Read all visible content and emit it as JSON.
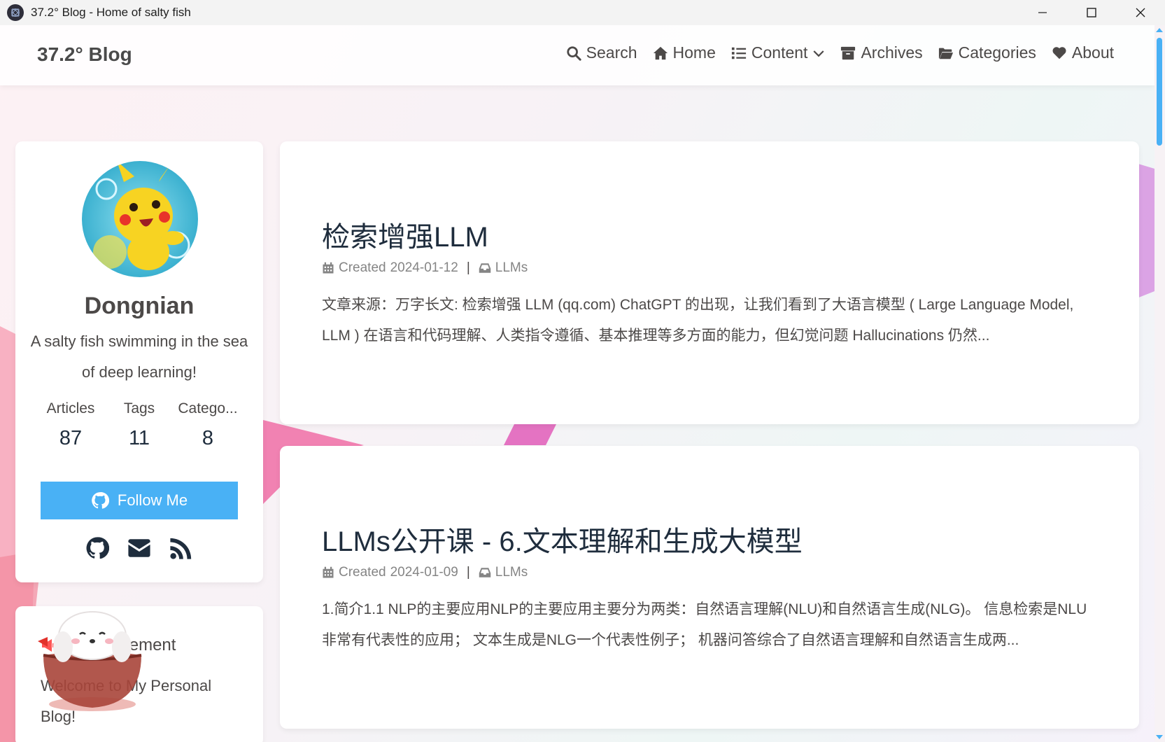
{
  "window": {
    "title": "37.2° Blog - Home of salty fish",
    "controls": [
      "minimize",
      "maximize",
      "close"
    ]
  },
  "navbar": {
    "site_name": "37.2° Blog",
    "menus": [
      {
        "label": "Search",
        "icon": "search-icon"
      },
      {
        "label": "Home",
        "icon": "home-icon"
      },
      {
        "label": "Content",
        "icon": "list-icon",
        "dropdown": true
      },
      {
        "label": "Archives",
        "icon": "archive-icon"
      },
      {
        "label": "Categories",
        "icon": "folder-open-icon"
      },
      {
        "label": "About",
        "icon": "heart-icon"
      }
    ]
  },
  "author": {
    "name": "Dongnian",
    "description": "A salty fish swimming in the sea of deep learning!",
    "stats": [
      {
        "label": "Articles",
        "value": "87"
      },
      {
        "label": "Tags",
        "value": "11"
      },
      {
        "label": "Catego...",
        "value": "8"
      }
    ],
    "follow_label": "Follow Me",
    "social": [
      "github-icon",
      "envelope-icon",
      "rss-icon"
    ]
  },
  "announcement": {
    "title": "Announcement",
    "text": "Welcome to My Personal Blog!"
  },
  "posts": [
    {
      "title": "检索增强LLM",
      "created_label": "Created",
      "date": "2024-01-12",
      "separator": "|",
      "category": "LLMs",
      "excerpt": "文章来源：万字长文: 检索增强 LLM (qq.com) ChatGPT 的出现，让我们看到了大语言模型 ( Large Language Model, LLM ) 在语言和代码理解、人类指令遵循、基本推理等多方面的能力，但幻觉问题 Hallucinations 仍然..."
    },
    {
      "title": "LLMs公开课 - 6.文本理解和生成大模型",
      "created_label": "Created",
      "date": "2024-01-09",
      "separator": "|",
      "category": "LLMs",
      "excerpt": "1.简介1.1 NLP的主要应用NLP的主要应用主要分为两类：自然语言理解(NLU)和自然语言生成(NLG)。 信息检索是NLU非常有代表性的应用； 文本生成是NLG一个代表性例子； 机器问答综合了自然语言理解和自然语言生成两..."
    }
  ],
  "colors": {
    "accent": "#49b1f5",
    "text": "#4c4948",
    "heading": "#1f2d3d",
    "meta": "#858585"
  }
}
